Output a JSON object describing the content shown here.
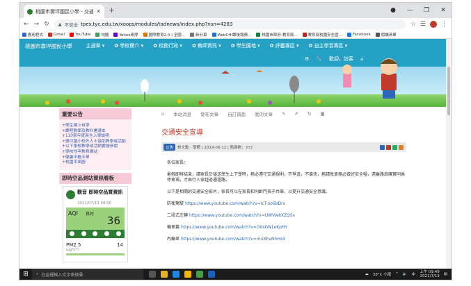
{
  "browser": {
    "tab_title": "桃園市壽坪國民小學 - 交通安全宣",
    "url": "tpes.tyc.edu.tw/xoops/modules/tadnews/index.php?nsn=4283",
    "not_secure": "不安全"
  },
  "bookmarks": [
    {
      "label": "應用程式",
      "color": "#3367d6"
    },
    {
      "label": "Gmail",
      "color": "#d93025"
    },
    {
      "label": "YouTube",
      "color": "#ff0000"
    },
    {
      "label": "地圖",
      "color": "#34a853"
    },
    {
      "label": "Yahoo奇摩",
      "color": "#6001d2"
    },
    {
      "label": "國際教育2.0 | 全國...",
      "color": "#e37400"
    },
    {
      "label": "新分頁",
      "color": "#777777"
    },
    {
      "label": "WebCHI課後服務...",
      "color": "#1a73e8"
    },
    {
      "label": "桃園市政府-教育局...",
      "color": "#188038"
    },
    {
      "label": "教育部校園安全暨...",
      "color": "#c5221f"
    },
    {
      "label": "Facebook",
      "color": "#1877f2"
    },
    {
      "label": "閱讀清單",
      "color": "#555555"
    }
  ],
  "site": {
    "school_name": "桃園市壽坪國民小學",
    "menu": [
      "主選單",
      "學校簡介",
      "校務行政",
      "教師資訊",
      "學生園地",
      "評鑑專區",
      "自主學習專區"
    ],
    "user_label": "歡迎，訪客"
  },
  "sidebar": {
    "announce_title": "重要公告",
    "announcements": [
      "學生線上自學",
      "課程教學及教科書選本",
      "110學年度新生入學說明",
      "壽坪國小校外人士協助教學或活動",
      "以下學校教學或活動實施參閱",
      "學校性平教育網站",
      "健康中樞五單",
      "校園平面圖"
    ],
    "aqi_title": "即時空品測站資訊看板",
    "aqi": {
      "station": "觀音 即時空品質資訊",
      "datetime": "2021/07/13 09:00",
      "label": "AQI",
      "level": "良好",
      "value": "36",
      "pm_label": "PM2.5",
      "pm_value": "14",
      "pm_unit": "(μg/m³)",
      "good_color": "#9bd17a"
    }
  },
  "article": {
    "nav": [
      "本站消息",
      "發布文章",
      "自訂頁面",
      "我的文章"
    ],
    "title": "交通安全宣導",
    "badge": "公告",
    "meta": "林文勳 - 學務 | 2019-06-12 | 點閱數：372",
    "greeting": "各位家長：",
    "para1": "暑假即將結束，請家長於接送學生上下學時，務必遵守交通規則，不爭道，不搶快，務請每車務必做好安全帽，遠離路肩確實同乘停車場，才由行人穿越道通過路。",
    "para2": "以下是相關的交通安全影片，家長可以在家長和同齡門孩子共學，以提升交通安全意識。",
    "videos": [
      {
        "label": "防衛駕駛",
        "link": "https://www.youtube.com/watch?v=IcT-soSbDrs"
      },
      {
        "label": "二段式左轉",
        "link": "https://www.youtube.com/watch?v=UWVw8XZQ5s"
      },
      {
        "label": "機車篇",
        "link": "https://www.youtube.com/watch?v=OVsGN1eKpHY"
      },
      {
        "label": "內輪差",
        "link": "https://www.youtube.com/watch?v=muXEvNhmI4"
      }
    ]
  },
  "taskbar": {
    "search_placeholder": "在這裡輸入文字來搜尋",
    "weather": "33°C 小雨",
    "lang": "中",
    "time": "上午 09:49",
    "date": "2021/7/13"
  }
}
